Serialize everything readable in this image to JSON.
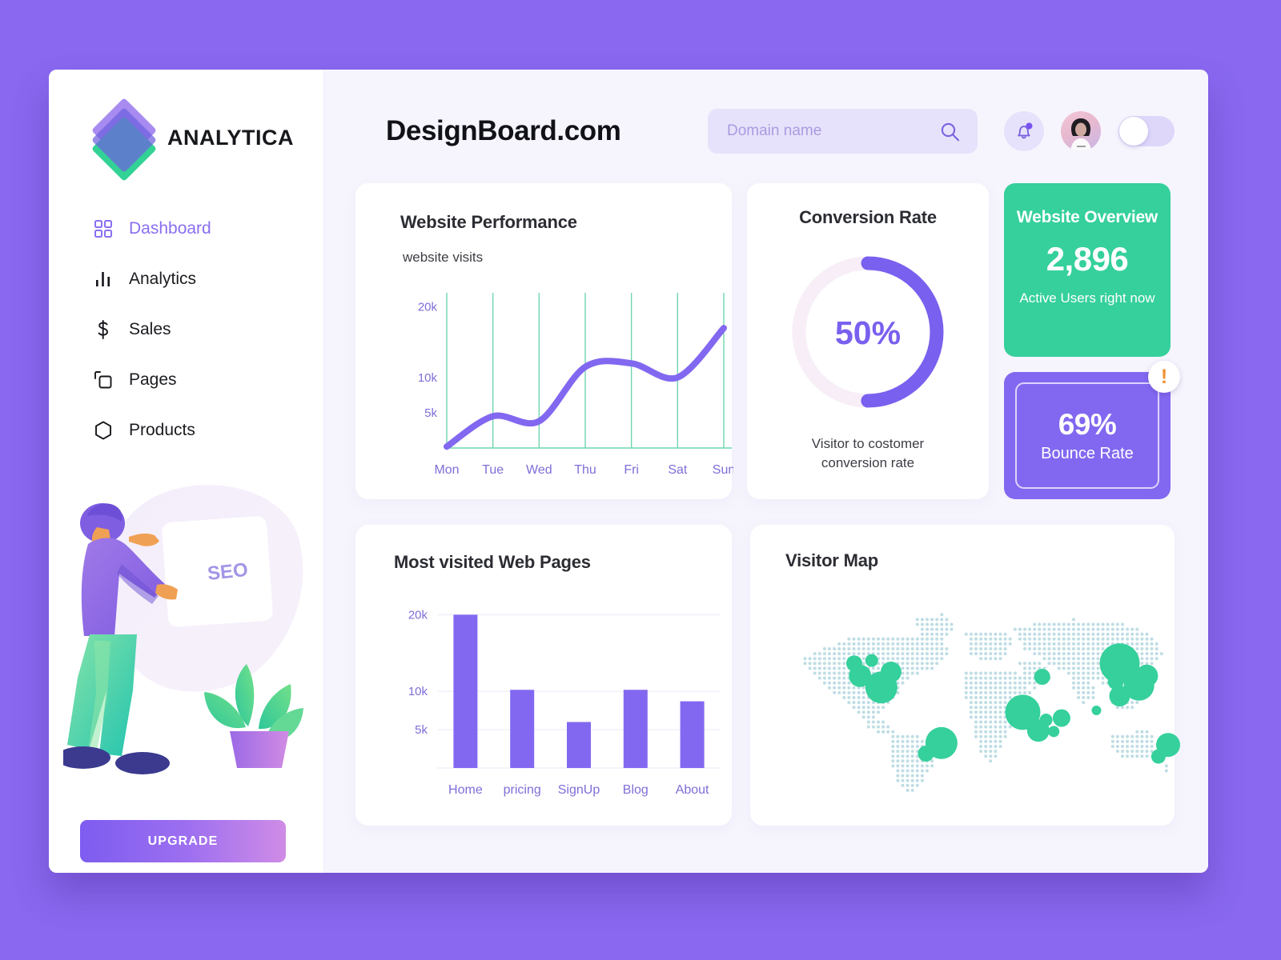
{
  "brand": {
    "name": "ANALYTICA",
    "logo_icon": "layered-diamond-logo"
  },
  "sidebar": {
    "items": [
      {
        "label": "Dashboard",
        "icon": "grid-icon",
        "active": true
      },
      {
        "label": "Analytics",
        "icon": "bar-chart-icon",
        "active": false
      },
      {
        "label": "Sales",
        "icon": "dollar-icon",
        "active": false
      },
      {
        "label": "Pages",
        "icon": "copy-pages-icon",
        "active": false
      },
      {
        "label": "Products",
        "icon": "hexagon-icon",
        "active": false
      }
    ],
    "illustration_label": "SEO",
    "upgrade_label": "UPGRADE"
  },
  "header": {
    "title": "DesignBoard.com",
    "search": {
      "placeholder": "Domain name",
      "value": "",
      "icon": "search-icon"
    },
    "bell_icon": "notification-bell-icon",
    "avatar_icon": "user-avatar",
    "toggle": {
      "state": "off",
      "icon": "toggle-switch"
    }
  },
  "cards": {
    "performance": {
      "title": "Website Performance",
      "subtitle": "website visits"
    },
    "conversion": {
      "title": "Conversion Rate",
      "value": "50%",
      "caption_line1": "Visitor to costomer",
      "caption_line2": "conversion rate"
    },
    "overview": {
      "title": "Website Overview",
      "value": "2,896",
      "subtitle": "Active Users right now",
      "color": "#35d09c"
    },
    "bounce": {
      "value": "69%",
      "label": "Bounce Rate",
      "alert_icon": "alert-exclamation-icon",
      "alert_glyph": "!",
      "color": "#8268f0",
      "alert_color": "#f09232"
    },
    "pages": {
      "title": "Most visited Web Pages"
    },
    "map": {
      "title": "Visitor Map",
      "dot_color": "#35d09c",
      "land_color": "#bfdde4"
    }
  },
  "chart_data": [
    {
      "type": "line",
      "title": "Website Performance",
      "subtitle": "website visits",
      "xlabel": "",
      "ylabel": "",
      "categories": [
        "Mon",
        "Tue",
        "Wed",
        "Thu",
        "Fri",
        "Sat",
        "Sun"
      ],
      "values": [
        200,
        4500,
        3800,
        11500,
        12000,
        10000,
        17000
      ],
      "ytick_labels": [
        "5k",
        "10k",
        "20k"
      ],
      "ytick_values": [
        5000,
        10000,
        20000
      ],
      "ylim": [
        0,
        22000
      ],
      "grid": "vertical",
      "line_color": "#8268f0",
      "grid_color": "#6fd6ae",
      "legend": "none"
    },
    {
      "type": "donut",
      "title": "Conversion Rate",
      "value": 50,
      "label": "50%",
      "track_color": "#f7eef8",
      "fill_color": "#7a60ef",
      "legend": "none"
    },
    {
      "type": "bar",
      "title": "Most visited Web Pages",
      "categories": [
        "Home",
        "pricing",
        "SignUp",
        "Blog",
        "About"
      ],
      "values": [
        20000,
        10200,
        6000,
        10200,
        8700
      ],
      "ytick_labels": [
        "5k",
        "10k",
        "20k"
      ],
      "ytick_values": [
        5000,
        10000,
        20000
      ],
      "ylim": [
        0,
        21500
      ],
      "xlabel": "",
      "ylabel": "",
      "grid": "horizontal",
      "bar_color": "#8268f0",
      "legend": "none"
    },
    {
      "type": "bubble-map",
      "title": "Visitor Map",
      "bubbles": [
        {
          "x": 0.19,
          "y": 0.33,
          "r": 10
        },
        {
          "x": 0.235,
          "y": 0.315,
          "r": 8
        },
        {
          "x": 0.285,
          "y": 0.375,
          "r": 13
        },
        {
          "x": 0.205,
          "y": 0.395,
          "r": 14
        },
        {
          "x": 0.26,
          "y": 0.455,
          "r": 20
        },
        {
          "x": 0.415,
          "y": 0.745,
          "r": 20
        },
        {
          "x": 0.375,
          "y": 0.8,
          "r": 10
        },
        {
          "x": 0.675,
          "y": 0.4,
          "r": 10
        },
        {
          "x": 0.625,
          "y": 0.585,
          "r": 22
        },
        {
          "x": 0.685,
          "y": 0.625,
          "r": 8
        },
        {
          "x": 0.725,
          "y": 0.615,
          "r": 11
        },
        {
          "x": 0.665,
          "y": 0.68,
          "r": 14
        },
        {
          "x": 0.705,
          "y": 0.685,
          "r": 7
        },
        {
          "x": 0.875,
          "y": 0.33,
          "r": 25
        },
        {
          "x": 0.945,
          "y": 0.395,
          "r": 14
        },
        {
          "x": 0.865,
          "y": 0.425,
          "r": 10
        },
        {
          "x": 0.925,
          "y": 0.445,
          "r": 19
        },
        {
          "x": 0.875,
          "y": 0.5,
          "r": 13
        },
        {
          "x": 0.815,
          "y": 0.575,
          "r": 6
        },
        {
          "x": 1.0,
          "y": 0.755,
          "r": 15
        },
        {
          "x": 0.975,
          "y": 0.815,
          "r": 9
        }
      ]
    }
  ]
}
